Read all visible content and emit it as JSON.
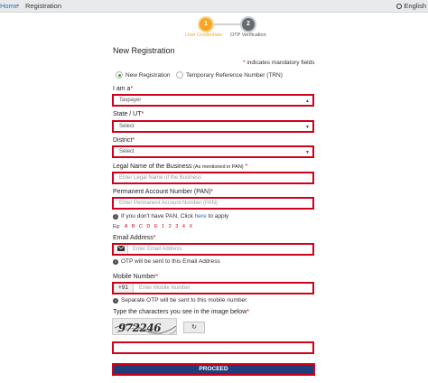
{
  "breadcrumb": {
    "home": "Home",
    "separator": "›",
    "current": "Registration"
  },
  "language": {
    "label": "English",
    "icon": "globe-icon"
  },
  "steps": [
    {
      "number": "1",
      "label": "User Credentials",
      "state": "active"
    },
    {
      "number": "2",
      "label": "OTP Verification",
      "state": "pending"
    }
  ],
  "form": {
    "title": "New Registration",
    "mandatory_star": "*",
    "mandatory_note": " indicates mandatory fields",
    "radio_options": [
      {
        "label": "New Registration",
        "selected": true
      },
      {
        "label": "Temporary Reference Number (TRN)",
        "selected": false
      }
    ],
    "i_am_a": {
      "label": "I am a",
      "value": "Taxpayer"
    },
    "state": {
      "label": "State / UT",
      "value": "Select"
    },
    "district": {
      "label": "District",
      "value": "Select"
    },
    "legal_name": {
      "label": "Legal Name of the Business",
      "label_small": " (As mentioned in PAN)",
      "placeholder": "Enter Legal Name of the Business"
    },
    "pan": {
      "label": "Permanent Account Number (PAN)",
      "placeholder": "Enter Permanent Account Number (PAN)",
      "help_prefix": "If you don't have PAN, Click ",
      "help_link": "here",
      "help_suffix": " to apply",
      "example_label": "Eg:",
      "example_chars": [
        "A",
        "B",
        "C",
        "D",
        "E",
        "1",
        "2",
        "3",
        "4",
        "X"
      ]
    },
    "email": {
      "label": "Email Address",
      "placeholder": "Enter Email Address",
      "icon": "envelope-icon",
      "help": "OTP will be sent to this Email Address"
    },
    "mobile": {
      "label": "Mobile Number",
      "prefix": "+91",
      "placeholder": "Enter Mobile Number",
      "help": "Separate OTP will be sent to this mobile number"
    },
    "captcha": {
      "label": "Type the characters you see in the image below",
      "image_text": "972246",
      "refresh_icon": "refresh-icon"
    },
    "proceed_label": "PROCEED",
    "required_star": "*"
  },
  "colors": {
    "accent_orange": "#f5a623",
    "error_red": "#d0021b",
    "primary_blue": "#1f3d7a",
    "link_blue": "#2a6ebb",
    "radio_green": "#2aa04a"
  }
}
